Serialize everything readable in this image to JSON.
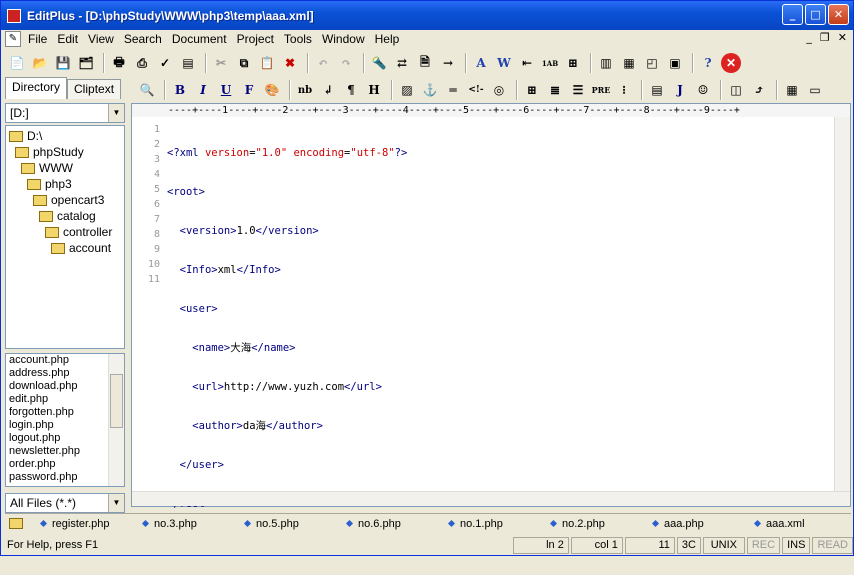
{
  "window": {
    "title": "EditPlus - [D:\\phpStudy\\WWW\\php3\\temp\\aaa.xml]"
  },
  "menu": [
    "File",
    "Edit",
    "View",
    "Search",
    "Document",
    "Project",
    "Tools",
    "Window",
    "Help"
  ],
  "sidebar": {
    "tabs": [
      "Directory",
      "Cliptext"
    ],
    "drive": "[D:]",
    "tree": [
      {
        "label": "D:\\",
        "indent": 0
      },
      {
        "label": "phpStudy",
        "indent": 1
      },
      {
        "label": "WWW",
        "indent": 2
      },
      {
        "label": "php3",
        "indent": 3
      },
      {
        "label": "opencart3",
        "indent": 4
      },
      {
        "label": "catalog",
        "indent": 5
      },
      {
        "label": "controller",
        "indent": 6
      },
      {
        "label": "account",
        "indent": 7
      }
    ],
    "files": [
      "account.php",
      "address.php",
      "download.php",
      "edit.php",
      "forgotten.php",
      "login.php",
      "logout.php",
      "newsletter.php",
      "order.php",
      "password.php"
    ],
    "filter": "All Files (*.*)"
  },
  "editor": {
    "ruler": "----+----1----+----2----+----3----+----4----+----5----+----6----+----7----+----8----+----9----+",
    "line_numbers": [
      "1",
      "2",
      "3",
      "4",
      "5",
      "6",
      "7",
      "8",
      "9",
      "10",
      "11"
    ]
  },
  "doc_tabs": [
    "register.php",
    "no.3.php",
    "no.5.php",
    "no.6.php",
    "no.1.php",
    "no.2.php",
    "aaa.php",
    "aaa.xml"
  ],
  "status": {
    "help": "For Help, press F1",
    "ln": "ln 2",
    "col": "col 1",
    "count": "11",
    "hex": "3C",
    "eol": "UNIX",
    "rec": "REC",
    "ins": "INS",
    "read": "READ"
  }
}
